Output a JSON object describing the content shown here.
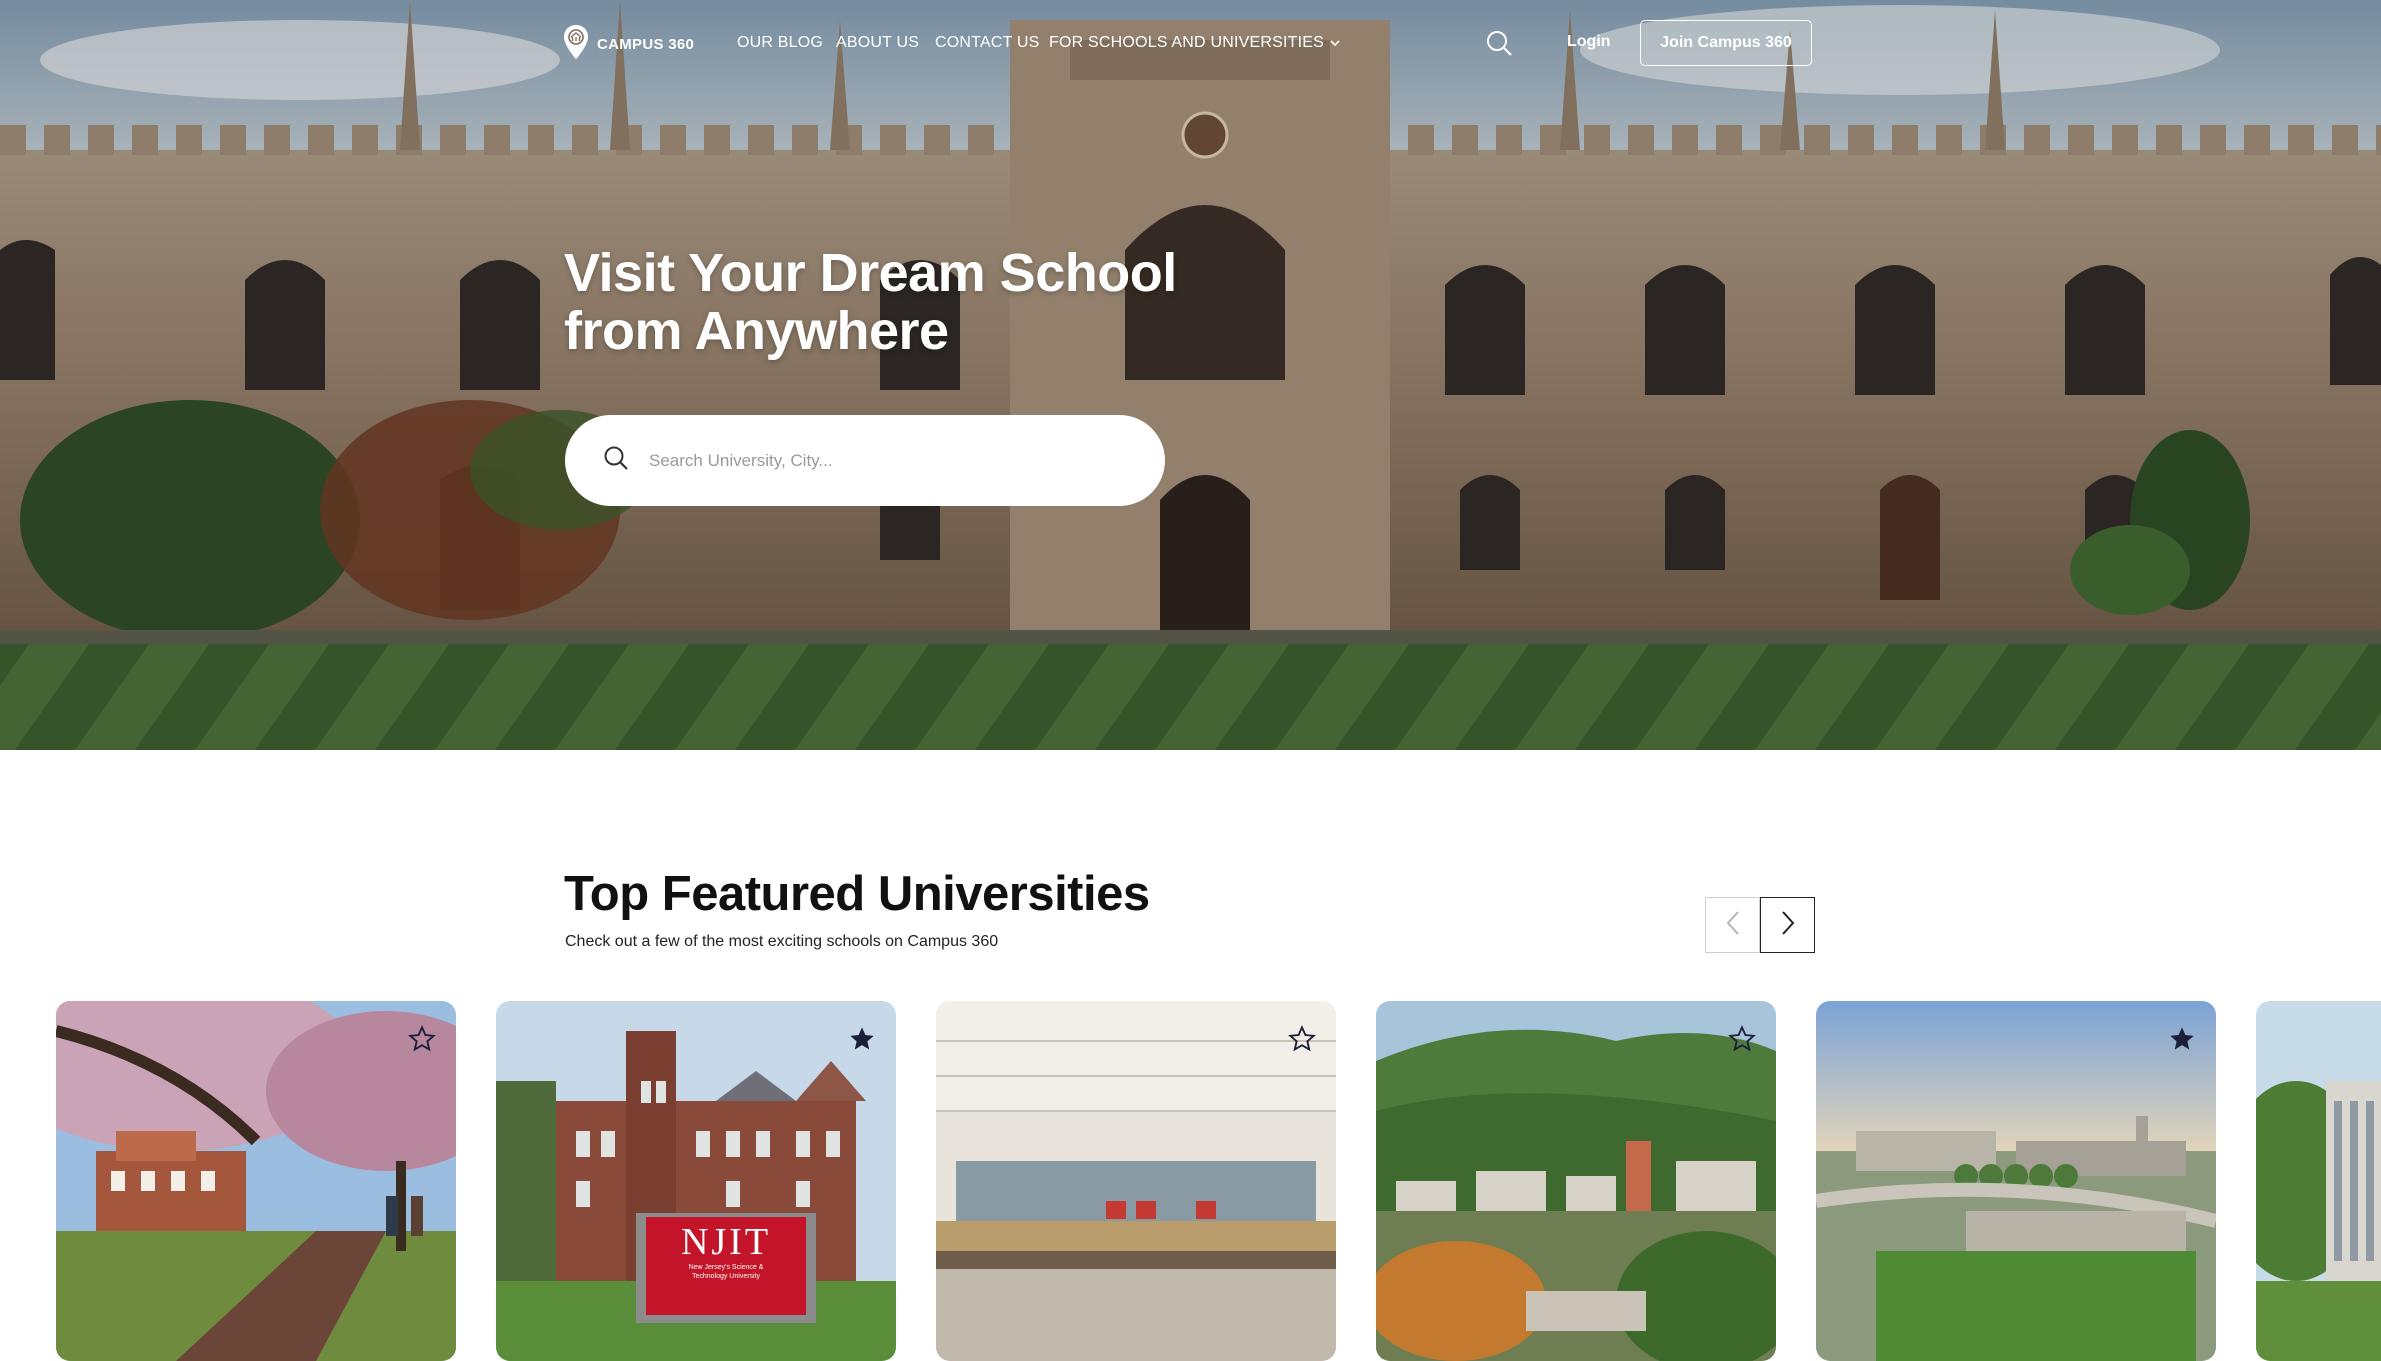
{
  "nav": {
    "logo_text": "CAMPUS 360",
    "links": [
      "OUR BLOG",
      "ABOUT US",
      "CONTACT US",
      "FOR SCHOOLS AND UNIVERSITIES"
    ],
    "login": "Login",
    "join": "Join Campus 360",
    "icons": {
      "logo": "location-pin-icon",
      "search": "search-icon",
      "dropdown": "chevron-down-icon"
    }
  },
  "hero": {
    "title_line1": "Visit Your Dream School",
    "title_line2": "from Anywhere",
    "search_placeholder": "Search University, City..."
  },
  "featured": {
    "title": "Top Featured Universities",
    "subtitle": "Check out a few of the most exciting schools on Campus 360",
    "cards": [
      {
        "favorite": false
      },
      {
        "favorite": true,
        "sign_text": "NJIT",
        "sign_subtext": "New Jersey's Science & Technology University"
      },
      {
        "favorite": false
      },
      {
        "favorite": false
      },
      {
        "favorite": true
      },
      {
        "favorite": false
      }
    ]
  },
  "colors": {
    "accent": "#ffffff",
    "text": "#111111",
    "sign_red": "#c4142a",
    "star": "#1c1f3a"
  }
}
